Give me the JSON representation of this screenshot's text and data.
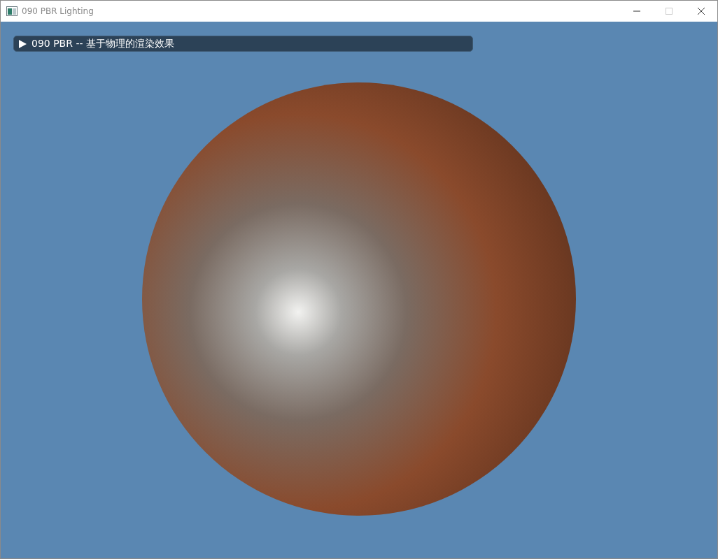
{
  "window": {
    "title": "090 PBR Lighting"
  },
  "panel": {
    "title": "090 PBR -- 基于物理的渲染效果",
    "expanded": false
  }
}
